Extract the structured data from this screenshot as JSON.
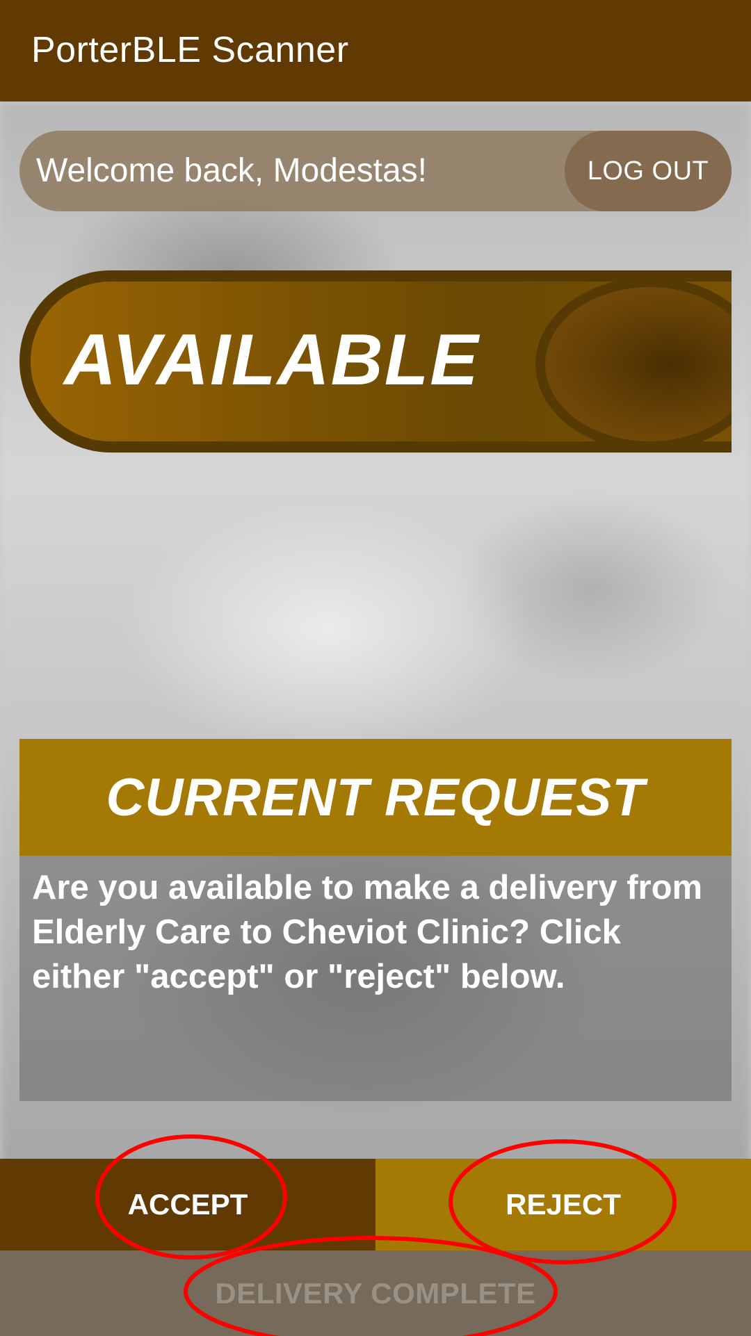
{
  "app_bar": {
    "title": "PorterBLE Scanner"
  },
  "welcome": {
    "message": "Welcome back, Modestas!",
    "logout_label": "LOG OUT"
  },
  "availability_toggle": {
    "label": "AVAILABLE",
    "on": true
  },
  "current_request": {
    "title": "CURRENT REQUEST",
    "message": "Are you available to make a delivery from Elderly Care to Cheviot Clinic? Click either \"accept\" or \"reject\" below."
  },
  "actions": {
    "accept_label": "ACCEPT",
    "reject_label": "REJECT",
    "complete_label": "DELIVERY COMPLETE"
  },
  "colors": {
    "primary_dark": "#613a03",
    "accent_gold": "#a47904",
    "disabled": "#766a5a",
    "annotation_red": "#ff0000"
  }
}
